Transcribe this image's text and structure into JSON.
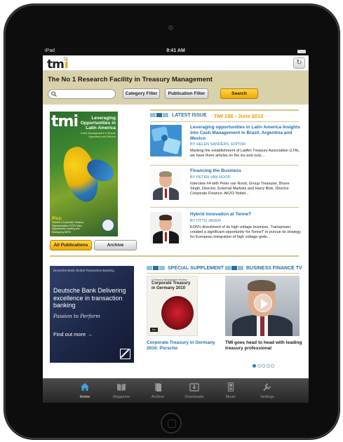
{
  "status_bar": {
    "carrier": "iPad",
    "time": "9:41 AM"
  },
  "header": {
    "logo_text": "tm",
    "logo_accent": "i",
    "refresh_icon": "refresh-icon"
  },
  "search_band": {
    "tagline": "The No 1 Research Facility in Treasury Management",
    "search_placeholder": "",
    "category_filter_label": "Category Filter",
    "publication_filter_label": "Publication Filter",
    "search_label": "Search"
  },
  "cover": {
    "masthead": "tmi",
    "headline": "Leveraging Opportunities in Latin America",
    "subheadline": "Cash Management in Brazil, Argentina and Mexico",
    "plus_label": "Plus:",
    "plus_text": "TenneT's Corporate Treasury Transformation; ECB Policy Adjustments Leading and Reshaping SEPA",
    "all_publications_label": "All Publications",
    "archive_label": "Archive"
  },
  "latest_issue": {
    "heading": "LATEST ISSUE",
    "issue_title": "TMI 186 - June 2010",
    "articles": [
      {
        "title": "Leveraging opportunities in Latin America Insights into Cash Management in Brazil, Argentina and Mexico",
        "author": "BY HELEN SANDERS, EDITOR",
        "description": "Marking the establishment of LatAm Treasury Association (LTA), we have three articles on the ins and outs..."
      },
      {
        "title": "Financing the Business",
        "author": "BY PETER VAN ROOD",
        "description": "Interview #4 with Peter van Rood, Group Treasurer, Brune Singh, Director, External Markets and Harry Blok, Director Corporate Finance, AKZO Nobel..."
      },
      {
        "title": "Hybrid Innovation at TenneT",
        "author": "BY OTTO JAGER",
        "description": "EON's divestment of its high voltage business, Transpower, created a significant opportunity for TenneT to pursue its strategy for European integration of high voltage grids..."
      }
    ]
  },
  "advert": {
    "brand": "Deutsche Bank Global Transaction Banking",
    "headline": "Deutsche Bank Delivering excellence in transaction banking",
    "tagline": "Passion to Perform",
    "cta": "Find out more →"
  },
  "special_supplement": {
    "heading": "SPECIAL SUPPLEMENT",
    "cover_pretitle": "A Treasury Management Review",
    "cover_title": "Corporate Treasury in Germany 2010",
    "cover_logo": "tm",
    "caption": "Corporate Treasury in Germany 2010: Porsche"
  },
  "business_tv": {
    "heading": "BUSINESS FINANCE TV",
    "caption": "TMI goes head to head with leading treasury professional",
    "pages": 5,
    "active_page": 1
  },
  "tab_bar": {
    "tabs": [
      {
        "label": "Home",
        "icon": "home-icon",
        "active": true
      },
      {
        "label": "Magazine",
        "icon": "open-book-icon",
        "active": false
      },
      {
        "label": "Archive",
        "icon": "archive-icon",
        "active": false
      },
      {
        "label": "Downloads",
        "icon": "download-icon",
        "active": false
      },
      {
        "label": "Music",
        "icon": "music-icon",
        "active": false
      },
      {
        "label": "Settings",
        "icon": "wrench-icon",
        "active": false
      }
    ]
  },
  "colors": {
    "accent_yellow": "#f0a800",
    "link_blue": "#1d6fa8",
    "band_beige": "#d9d1aa",
    "section_teal": "#2a6f97"
  }
}
